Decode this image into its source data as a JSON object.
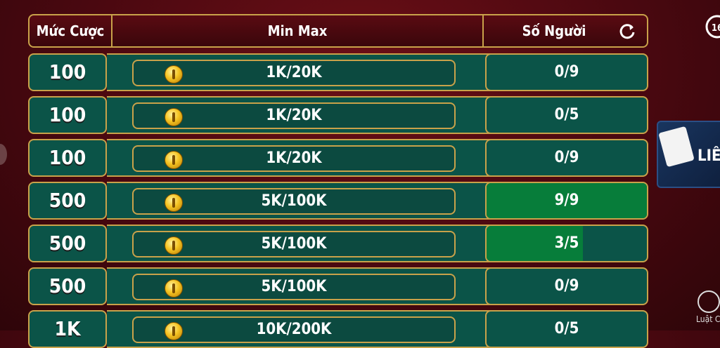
{
  "header": {
    "bet_label": "Mức Cược",
    "range_label": "Min Max",
    "players_label": "Số Người"
  },
  "rows": [
    {
      "bet": "100",
      "range": "1K/20K",
      "players": "0/9",
      "fill": 0.0
    },
    {
      "bet": "100",
      "range": "1K/20K",
      "players": "0/5",
      "fill": 0.0
    },
    {
      "bet": "100",
      "range": "1K/20K",
      "players": "0/9",
      "fill": 0.0
    },
    {
      "bet": "500",
      "range": "5K/100K",
      "players": "9/9",
      "fill": 1.0
    },
    {
      "bet": "500",
      "range": "5K/100K",
      "players": "3/5",
      "fill": 0.6
    },
    {
      "bet": "500",
      "range": "5K/100K",
      "players": "0/9",
      "fill": 0.0
    },
    {
      "bet": "1K",
      "range": "10K/200K",
      "players": "0/5",
      "fill": 0.0
    }
  ],
  "side": {
    "clock_text": "16",
    "card_text": "LIÊ",
    "rule_text": "Luật C"
  },
  "colors": {
    "gold": "#c9a24a",
    "teal": "#0b5448",
    "green_fill": "#077d3a",
    "bg": "#4a0810"
  }
}
